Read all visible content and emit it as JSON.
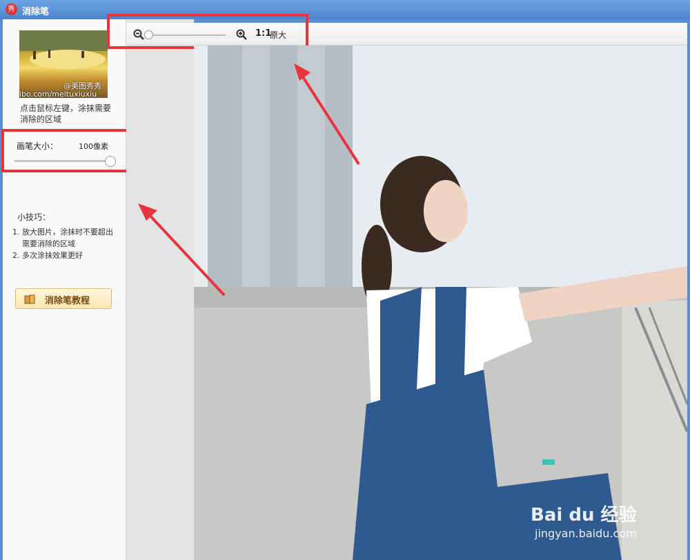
{
  "window": {
    "title": "消除笔",
    "app_icon_char": "秀"
  },
  "sidebar": {
    "thumbnail_watermark_handle": "@美图秀秀",
    "thumbnail_watermark_url": "ibo.com/meituxiuxiu",
    "hint": "点击鼠标左键，涂抹需要消除的区域",
    "brush_size": {
      "label": "画笔大小：",
      "value_text": "100像素",
      "level": 1.0
    },
    "tips_title": "小技巧：",
    "tips": [
      {
        "num": "1.",
        "text": "放大图片，涂抹时不要超出需要消除的区域"
      },
      {
        "num": "2.",
        "text": "多次涂抹效果更好"
      }
    ],
    "tutorial_button": "消除笔教程"
  },
  "toolbar": {
    "zoom_level": 0.0,
    "ratio_label": "1:1",
    "actual_size_label": "原大"
  },
  "watermark": {
    "brand": "Bai du 经验",
    "url": "jingyan.baidu.com"
  },
  "colors": {
    "highlight_red": "#e8343a",
    "title_blue": "#4a86d0"
  }
}
